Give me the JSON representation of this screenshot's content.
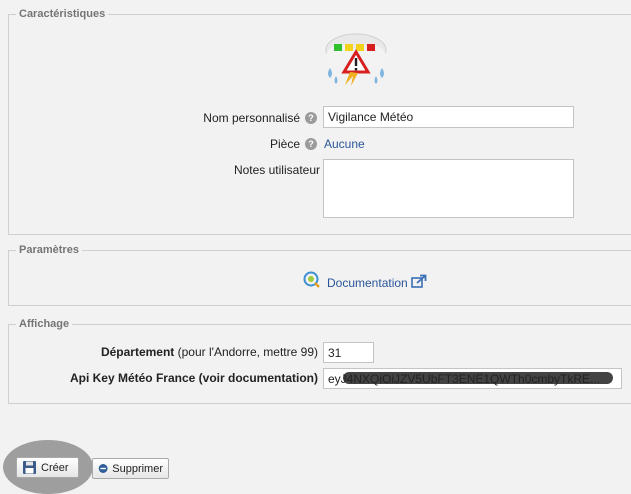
{
  "sections": {
    "characteristics": "Caractéristiques",
    "parameters": "Paramètres",
    "display": "Affichage"
  },
  "fields": {
    "custom_name_label": "Nom personnalisé",
    "custom_name_value": "Vigilance Météo",
    "room_label": "Pièce",
    "room_value": "Aucune",
    "notes_label": "Notes utilisateur",
    "notes_value": "",
    "help_glyph": "?"
  },
  "parameters": {
    "documentation_link": "Documentation"
  },
  "display": {
    "department_label": "Département",
    "department_hint": "(pour l'Andorre, mettre 99)",
    "department_value": "31",
    "api_key_label": "Api Key Météo France (voir documentation)",
    "api_key_value": "eyJ4NXQiOiJZV5UbFT3ENE1QWTh0cmbyTkRE..."
  },
  "buttons": {
    "create": "Créer",
    "delete": "Supprimer"
  },
  "colors": {
    "link": "#2a5699",
    "highlight": "#9e9e9e",
    "warning_yellow": "#f2d21b",
    "warning_red": "#d71f1f"
  },
  "icons": {
    "plugin": "weather-warning-icon",
    "documentation": "book-icon",
    "external": "external-link-icon",
    "create": "save-icon",
    "delete": "minus-circle-icon"
  }
}
